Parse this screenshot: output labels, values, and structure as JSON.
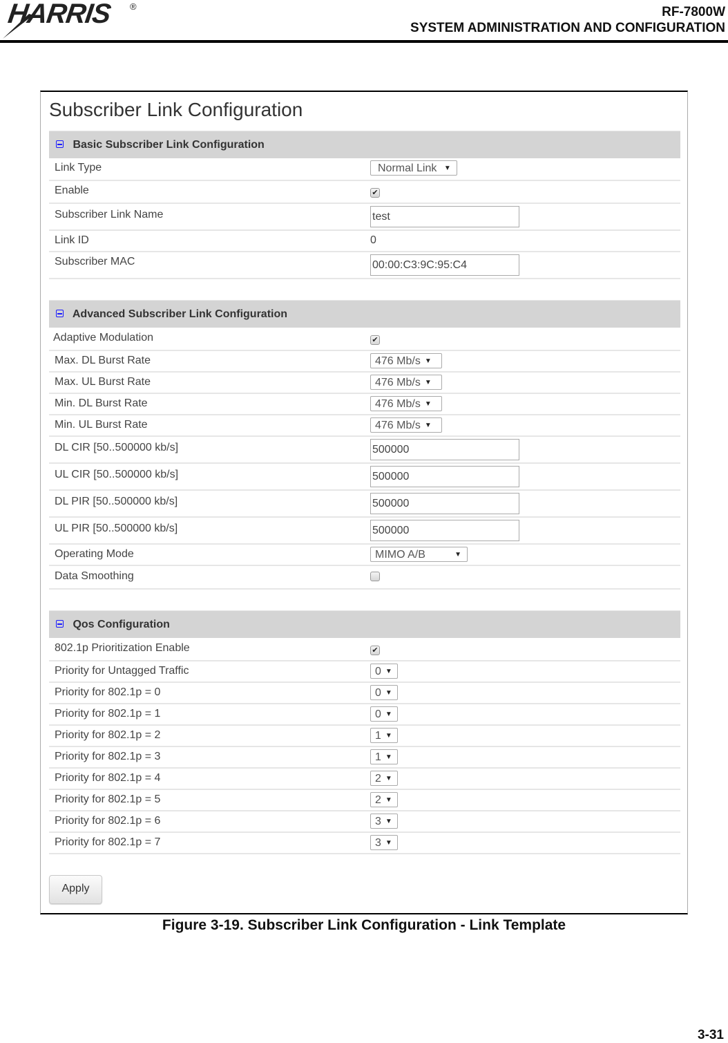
{
  "header": {
    "logo_text": "HARRIS",
    "logo_registered": "®",
    "doc_model": "RF-7800W",
    "doc_section": "SYSTEM ADMINISTRATION AND CONFIGURATION"
  },
  "page_title": "Subscriber Link Configuration",
  "sections": {
    "basic": {
      "title": "Basic Subscriber Link Configuration",
      "link_type": {
        "label": "Link Type",
        "value": "Normal Link"
      },
      "enable": {
        "label": "Enable",
        "checked": true
      },
      "link_name": {
        "label": "Subscriber Link Name",
        "value": "test"
      },
      "link_id": {
        "label": "Link ID",
        "value": "0"
      },
      "subscriber_mac": {
        "label": "Subscriber MAC",
        "value": "00:00:C3:9C:95:C4"
      }
    },
    "advanced": {
      "title": "Advanced Subscriber Link Configuration",
      "adaptive_modulation": {
        "label": "Adaptive Modulation",
        "checked": true
      },
      "max_dl_burst": {
        "label": "Max. DL Burst Rate",
        "value": "476 Mb/s"
      },
      "max_ul_burst": {
        "label": "Max. UL Burst Rate",
        "value": "476 Mb/s"
      },
      "min_dl_burst": {
        "label": "Min. DL Burst Rate",
        "value": "476 Mb/s"
      },
      "min_ul_burst": {
        "label": "Min. UL Burst Rate",
        "value": "476 Mb/s"
      },
      "dl_cir": {
        "label": "DL CIR [50..500000 kb/s]",
        "value": "500000"
      },
      "ul_cir": {
        "label": "UL CIR [50..500000 kb/s]",
        "value": "500000"
      },
      "dl_pir": {
        "label": "DL PIR [50..500000 kb/s]",
        "value": "500000"
      },
      "ul_pir": {
        "label": "UL PIR [50..500000 kb/s]",
        "value": "500000"
      },
      "operating_mode": {
        "label": "Operating Mode",
        "value": "MIMO A/B"
      },
      "data_smoothing": {
        "label": "Data Smoothing",
        "checked": false
      }
    },
    "qos": {
      "title": "Qos Configuration",
      "prioritization_enable": {
        "label": "802.1p Prioritization Enable",
        "checked": true
      },
      "priorities": [
        {
          "label": "Priority for Untagged Traffic",
          "value": "0"
        },
        {
          "label": "Priority for 802.1p = 0",
          "value": "0"
        },
        {
          "label": "Priority for 802.1p = 1",
          "value": "0"
        },
        {
          "label": "Priority for 802.1p = 2",
          "value": "1"
        },
        {
          "label": "Priority for 802.1p = 3",
          "value": "1"
        },
        {
          "label": "Priority for 802.1p = 4",
          "value": "2"
        },
        {
          "label": "Priority for 802.1p = 5",
          "value": "2"
        },
        {
          "label": "Priority for 802.1p = 6",
          "value": "3"
        },
        {
          "label": "Priority for 802.1p = 7",
          "value": "3"
        }
      ]
    }
  },
  "apply_label": "Apply",
  "caption": "Figure 3-19.  Subscriber Link Configuration - Link Template",
  "page_number": "3-31",
  "icons": {
    "dropdown_arrow": "▼",
    "check_mark": "✔"
  }
}
